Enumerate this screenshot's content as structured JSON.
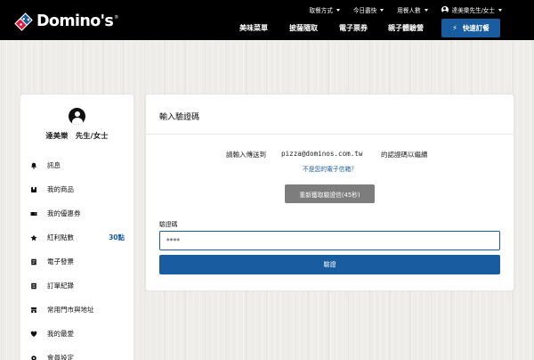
{
  "brand": {
    "name": "Domino's",
    "trademark": "®",
    "colors": {
      "blue": "#1a5ca0",
      "red": "#e31837",
      "header_bg": "#000000",
      "disabled_gray": "#7d7d7d"
    }
  },
  "utility_bar": {
    "items": [
      {
        "label": "取餐方式",
        "icon": "caret-down-icon"
      },
      {
        "label": "今日盡快",
        "icon": "caret-down-icon"
      },
      {
        "label": "用餐人數",
        "icon": "caret-down-icon"
      }
    ],
    "user": {
      "label": "達美樂先生/女士",
      "icon": "user-circle-icon"
    }
  },
  "main_nav": {
    "items": [
      {
        "label": "美味菜單"
      },
      {
        "label": "披薩隨取"
      },
      {
        "label": "電子票券"
      },
      {
        "label": "親子體驗營"
      }
    ],
    "quick_order": {
      "label": "快速訂餐",
      "icon": "bolt-icon"
    }
  },
  "sidebar": {
    "user_name": "達美樂　先生/女士",
    "items": [
      {
        "label": "訊息",
        "icon": "bell-icon"
      },
      {
        "label": "我的商品",
        "icon": "box-icon"
      },
      {
        "label": "我的優惠券",
        "icon": "ticket-icon"
      },
      {
        "label": "紅利點數",
        "icon": "star-icon",
        "value": "30點"
      },
      {
        "label": "電子發票",
        "icon": "invoice-icon"
      },
      {
        "label": "訂單紀錄",
        "icon": "receipt-icon"
      },
      {
        "label": "常用門市與地址",
        "icon": "store-icon"
      },
      {
        "label": "我的最愛",
        "icon": "heart-icon"
      },
      {
        "label": "會員設定",
        "icon": "settings-icon"
      }
    ]
  },
  "verify": {
    "title": "輸入驗證碼",
    "send_prefix": "請輸入傳送到",
    "email": "pizza@dominos.com.tw",
    "send_suffix": "的認證碼以繼續",
    "not_your_email": "不是您的電子信箱？",
    "resend_label": "重新獲取驗證信(45秒)",
    "code_label": "驗證碼",
    "code_value": "****",
    "submit_label": "驗證"
  }
}
